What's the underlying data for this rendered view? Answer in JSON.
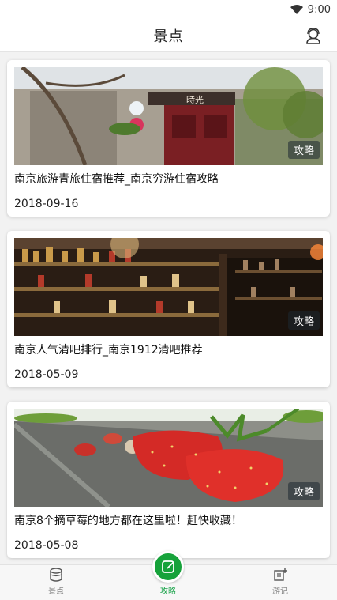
{
  "status_bar": {
    "time": "9:00",
    "icon": "wifi-icon"
  },
  "header": {
    "title": "景点",
    "profile_icon": "user-profile-icon"
  },
  "cards": [
    {
      "title": "南京旅游青旅住宿推荐_南京穷游住宿攻略",
      "date": "2018-09-16",
      "tag": "攻略",
      "image_sign": "時光"
    },
    {
      "title": "南京人气清吧排行_南京1912清吧推荐",
      "date": "2018-05-09",
      "tag": "攻略"
    },
    {
      "title": "南京8个摘草莓的地方都在这里啦！赶快收藏！",
      "date": "2018-05-08",
      "tag": "攻略"
    }
  ],
  "tabs": [
    {
      "label": "景点",
      "icon": "landmark-icon",
      "active": false
    },
    {
      "label": "攻略",
      "icon": "guide-icon",
      "active": true
    },
    {
      "label": "游记",
      "icon": "travel-notes-icon",
      "active": false
    }
  ],
  "colors": {
    "accent": "#16a23a",
    "tag_bg": "#2d3a47"
  }
}
